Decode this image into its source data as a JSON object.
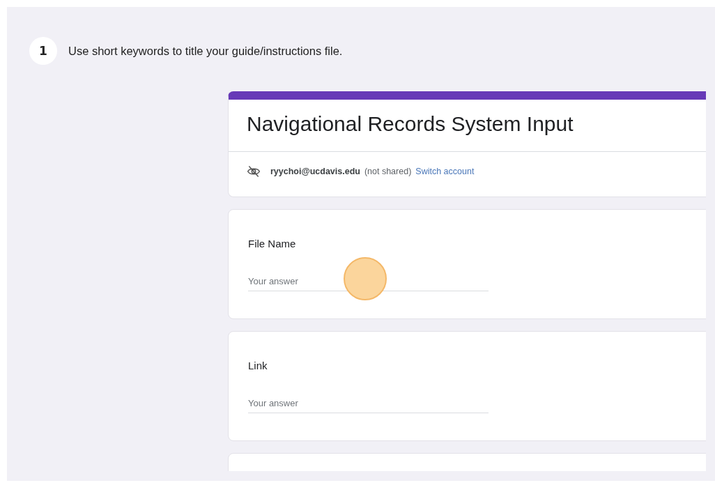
{
  "step": {
    "number": "1",
    "instruction": "Use short keywords to title your guide/instructions file."
  },
  "form": {
    "title": "Navigational Records System Input",
    "account": {
      "email": "ryychoi@ucdavis.edu",
      "note": "(not shared)",
      "link": "Switch account"
    },
    "questions": [
      {
        "label": "File Name",
        "placeholder": "Your answer",
        "clicked": true
      },
      {
        "label": "Link",
        "placeholder": "Your answer",
        "clicked": false
      }
    ]
  }
}
